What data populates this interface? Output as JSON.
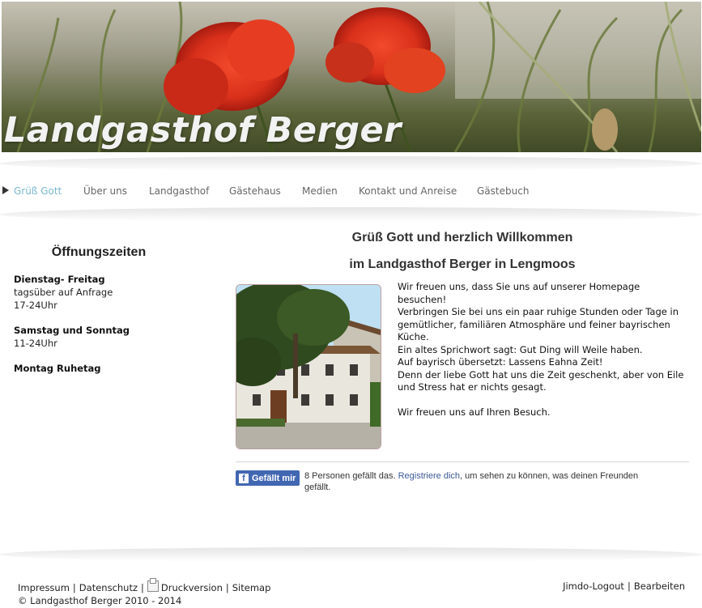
{
  "header": {
    "site_title": "Landgasthof Berger"
  },
  "nav": {
    "items": [
      {
        "label": "Grüß Gott",
        "active": true
      },
      {
        "label": "Über uns"
      },
      {
        "label": "Landgasthof"
      },
      {
        "label": "Gästehaus"
      },
      {
        "label": "Medien"
      },
      {
        "label": "Kontakt und Anreise"
      },
      {
        "label": "Gästebuch"
      }
    ]
  },
  "sidebar": {
    "title": "Öffnungszeiten",
    "blocks": [
      {
        "heading": "Dienstag- Freitag",
        "lines": [
          "tagsüber auf Anfrage",
          "17-24Uhr"
        ]
      },
      {
        "heading": "Samstag und Sonntag",
        "lines": [
          "11-24Uhr"
        ]
      },
      {
        "heading": "Montag Ruhetag"
      }
    ]
  },
  "main": {
    "heading_line1": "Grüß Gott und herzlich Willkommen",
    "heading_line2": "im Landgasthof Berger in Lengmoos",
    "intro_lines": [
      "Wir freuen uns, dass Sie uns auf unserer Homepage besuchen!",
      "Verbringen Sie bei uns ein paar ruhige Stunden oder Tage in gemütlicher, familiären Atmosphäre und feiner bayrischen Küche.",
      "Ein altes Sprichwort sagt: Gut Ding will Weile haben.",
      "Auf bayrisch übersetzt: Lassens Eahna Zeit!",
      "Denn der liebe Gott hat uns die Zeit geschenkt, aber von Eile und Stress hat er nichts gesagt."
    ],
    "closing": "Wir freuen uns auf Ihren Besuch.",
    "like": {
      "button_label": "Gefällt mir",
      "count_text": "8 Personen gefällt das.",
      "register_link": "Registriere dich",
      "rest_text": ", um sehen zu können, was deinen Freunden gefällt."
    }
  },
  "footer": {
    "impressum": "Impressum",
    "datenschutz": "Datenschutz",
    "druckversion": "Druckversion",
    "sitemap": "Sitemap",
    "copyright": "© Landgasthof Berger 2010 - 2014",
    "logout": "Jimdo-Logout",
    "bearbeiten": "Bearbeiten"
  }
}
